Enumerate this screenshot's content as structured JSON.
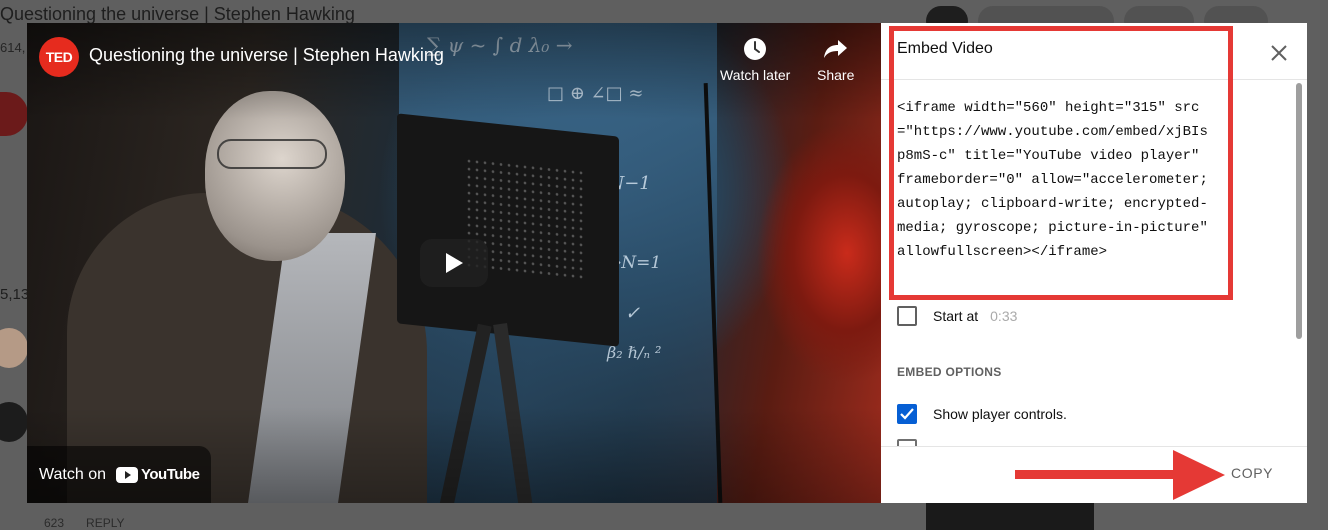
{
  "background": {
    "page_title": "Questioning the universe | Stephen Hawking",
    "views_fragment": "614,",
    "comment_count_fragment": "5,13",
    "like_count": "623",
    "reply_label": "REPLY"
  },
  "player": {
    "channel_logo": "TED",
    "title": "Questioning the universe | Stephen Hawking",
    "watch_later_label": "Watch later",
    "share_label": "Share",
    "watch_on_label": "Watch on",
    "youtube_brand": "YouTube",
    "icons": [
      "clock-icon",
      "share-arrow-icon",
      "play-icon",
      "youtube-logo-icon"
    ]
  },
  "embed_panel": {
    "title": "Embed Video",
    "code": "<iframe width=\"560\" height=\"315\" src=\"https://www.youtube.com/embed/xjBIsp8mS-c\" title=\"YouTube video player\" frameborder=\"0\" allow=\"accelerometer; autoplay; clipboard-write; encrypted-media; gyroscope; picture-in-picture\" allowfullscreen></iframe>",
    "start_at_label": "Start at",
    "start_at_time": "0:33",
    "start_at_checked": false,
    "options_heading": "EMBED OPTIONS",
    "show_controls_label": "Show player controls.",
    "show_controls_checked": true,
    "copy_label": "COPY"
  },
  "annotations": {
    "highlight_color": "#e53935",
    "arrow_color": "#e53935"
  }
}
